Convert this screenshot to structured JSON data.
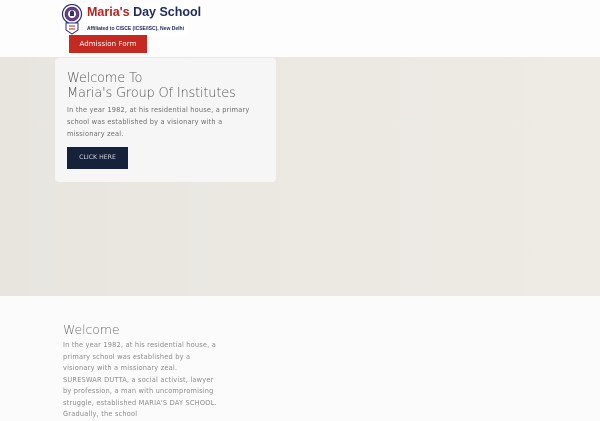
{
  "header": {
    "logo_name_part1": "Maria's",
    "logo_name_part2": "Day School",
    "logo_affiliation": "Affiliated to CISCE (ICSE/ISC), New Delhi",
    "admission_label": "Admission Form"
  },
  "hero": {
    "title_line1": "Welcome To",
    "title_line2": "Maria's Group Of Institutes",
    "text": "In the year 1982, at his residential house, a primary school was established by a visionary with a missionary zeal.",
    "button_label": "CLICK HERE"
  },
  "welcome": {
    "heading": "Welcome",
    "text": "In the year 1982, at his residential house, a primary school was established by a visionary with a missionary zeal. SURESWAR DUTTA, a social activist, lawyer by profession, a man with uncompromising struggle, established MARIA'S DAY SCHOOL. Gradually, the school"
  },
  "colors": {
    "accent_red": "#c42a21",
    "navy": "#15223a"
  }
}
